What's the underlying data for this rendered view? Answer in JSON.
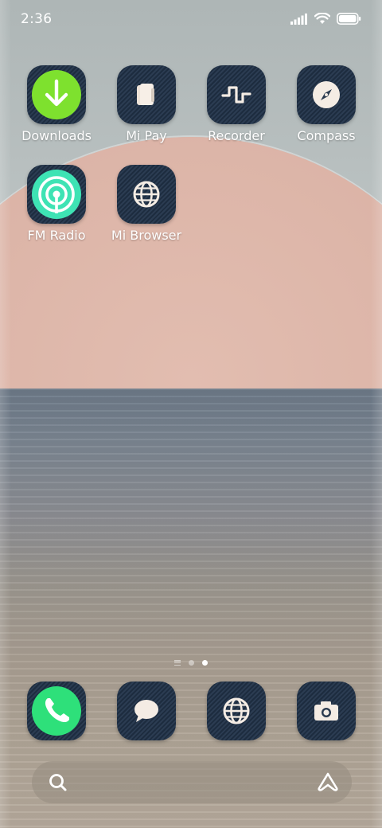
{
  "status_bar": {
    "time": "2:36",
    "icons": [
      "signal-icon",
      "wifi-icon",
      "battery-icon"
    ]
  },
  "apps": [
    {
      "label": "Downloads",
      "icon": "download-icon",
      "accent": "#7ee12e"
    },
    {
      "label": "Mi Pay",
      "icon": "wallet-icon"
    },
    {
      "label": "Recorder",
      "icon": "waveform-icon"
    },
    {
      "label": "Compass",
      "icon": "compass-icon"
    },
    {
      "label": "FM Radio",
      "icon": "radio-icon",
      "accent": "#3ee3b4"
    },
    {
      "label": "Mi Browser",
      "icon": "globe-icon"
    }
  ],
  "dock": [
    {
      "icon": "phone-icon",
      "accent": "#2ee07a"
    },
    {
      "icon": "message-icon"
    },
    {
      "icon": "globe-icon"
    },
    {
      "icon": "camera-icon"
    }
  ],
  "page_indicator": {
    "pages": 2,
    "current": 2
  },
  "search": {
    "icons": [
      "search-icon",
      "assistant-icon"
    ]
  }
}
